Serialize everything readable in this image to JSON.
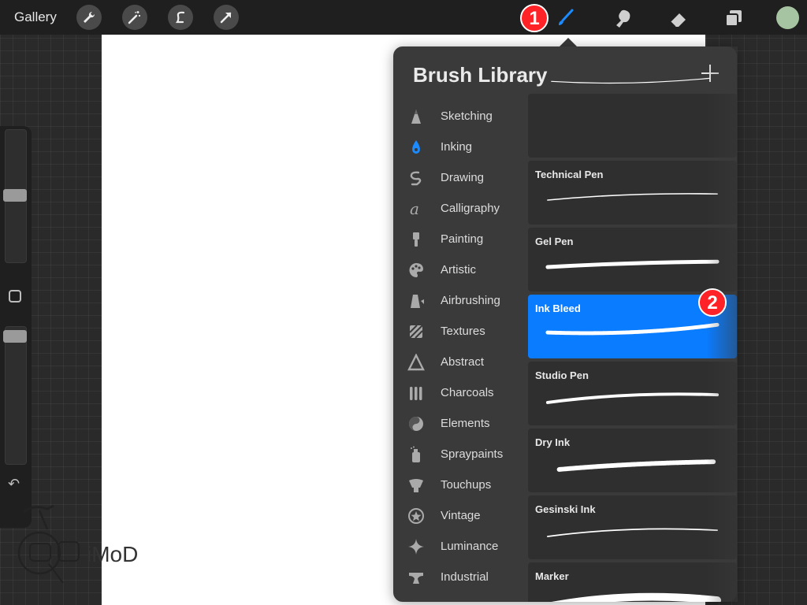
{
  "topbar": {
    "gallery_label": "Gallery",
    "left_tools": [
      "wrench-icon",
      "magic-wand-icon",
      "selection-icon",
      "transform-arrow-icon"
    ],
    "right_tools": [
      "brush-icon",
      "smudge-icon",
      "eraser-icon",
      "layers-icon"
    ],
    "active_tool": "brush-icon",
    "color_swatch": "#a7c4a2"
  },
  "badges": {
    "first": "1",
    "second": "2"
  },
  "panel": {
    "title": "Brush Library",
    "categories": [
      {
        "label": "Sketching",
        "icon": "pencil-tip-icon"
      },
      {
        "label": "Inking",
        "icon": "ink-drop-icon",
        "active": true
      },
      {
        "label": "Drawing",
        "icon": "squiggle-icon"
      },
      {
        "label": "Calligraphy",
        "icon": "calligraphy-icon"
      },
      {
        "label": "Painting",
        "icon": "paintbrush-icon"
      },
      {
        "label": "Artistic",
        "icon": "palette-icon"
      },
      {
        "label": "Airbrushing",
        "icon": "airbrush-icon"
      },
      {
        "label": "Textures",
        "icon": "texture-icon"
      },
      {
        "label": "Abstract",
        "icon": "triangle-icon"
      },
      {
        "label": "Charcoals",
        "icon": "charcoal-icon"
      },
      {
        "label": "Elements",
        "icon": "yin-yang-icon"
      },
      {
        "label": "Spraypaints",
        "icon": "spraycan-icon"
      },
      {
        "label": "Touchups",
        "icon": "touchup-icon"
      },
      {
        "label": "Vintage",
        "icon": "star-badge-icon"
      },
      {
        "label": "Luminance",
        "icon": "sparkle-icon"
      },
      {
        "label": "Industrial",
        "icon": "anvil-icon"
      }
    ],
    "brushes": [
      {
        "name": ""
      },
      {
        "name": "Technical Pen"
      },
      {
        "name": "Gel Pen"
      },
      {
        "name": "Ink Bleed",
        "selected": true
      },
      {
        "name": "Studio Pen"
      },
      {
        "name": "Dry Ink"
      },
      {
        "name": "Gesinski Ink"
      },
      {
        "name": "Marker"
      }
    ]
  },
  "watermark": {
    "text": "iMoD"
  },
  "colors": {
    "accent": "#0a7cff",
    "badge": "#ff2226"
  }
}
